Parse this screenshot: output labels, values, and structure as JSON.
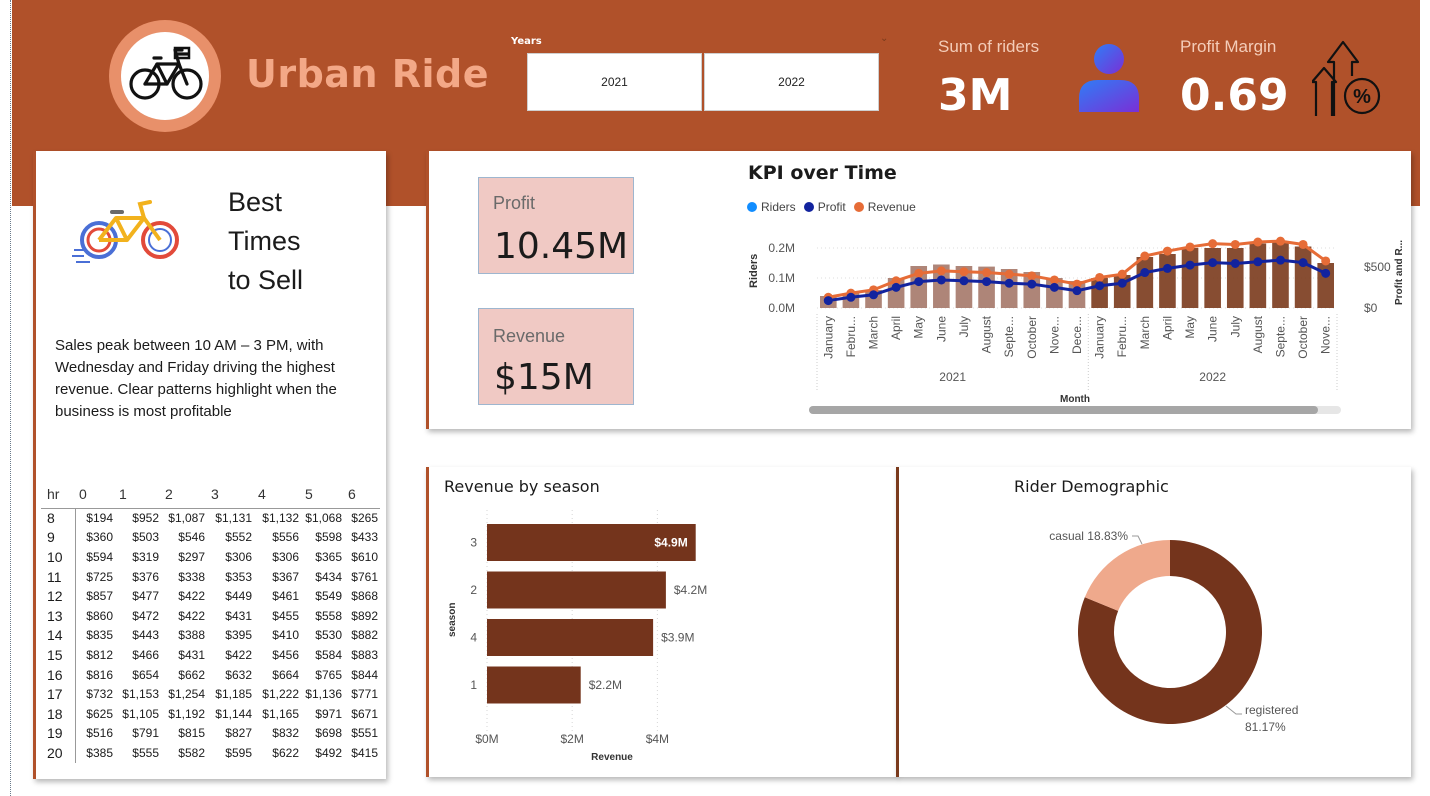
{
  "header": {
    "brand": "Urban Ride",
    "years_label": "Years",
    "years": [
      "2021",
      "2022"
    ],
    "sum_riders_label": "Sum of riders",
    "sum_riders_value": "3M",
    "profit_margin_label": "Profit Margin",
    "profit_margin_value": "0.69",
    "colors": {
      "banner": "#b0512a",
      "accent": "#f3a887"
    }
  },
  "best_times": {
    "title_lines": [
      "Best",
      "Times",
      "to Sell"
    ],
    "description": "Sales peak between 10 AM – 3 PM, with Wednesday and Friday driving the highest revenue. Clear patterns highlight when the business is most profitable",
    "table": {
      "header": [
        "hr",
        "0",
        "1",
        "2",
        "3",
        "4",
        "5",
        "6"
      ],
      "rows": [
        [
          "8",
          "$194",
          "$952",
          "$1,087",
          "$1,131",
          "$1,132",
          "$1,068",
          "$265"
        ],
        [
          "9",
          "$360",
          "$503",
          "$546",
          "$552",
          "$556",
          "$598",
          "$433"
        ],
        [
          "10",
          "$594",
          "$319",
          "$297",
          "$306",
          "$306",
          "$365",
          "$610"
        ],
        [
          "11",
          "$725",
          "$376",
          "$338",
          "$353",
          "$367",
          "$434",
          "$761"
        ],
        [
          "12",
          "$857",
          "$477",
          "$422",
          "$449",
          "$461",
          "$549",
          "$868"
        ],
        [
          "13",
          "$860",
          "$472",
          "$422",
          "$431",
          "$455",
          "$558",
          "$892"
        ],
        [
          "14",
          "$835",
          "$443",
          "$388",
          "$395",
          "$410",
          "$530",
          "$882"
        ],
        [
          "15",
          "$812",
          "$466",
          "$431",
          "$422",
          "$456",
          "$584",
          "$883"
        ],
        [
          "16",
          "$816",
          "$654",
          "$662",
          "$632",
          "$664",
          "$765",
          "$844"
        ],
        [
          "17",
          "$732",
          "$1,153",
          "$1,254",
          "$1,185",
          "$1,222",
          "$1,136",
          "$771"
        ],
        [
          "18",
          "$625",
          "$1,105",
          "$1,192",
          "$1,144",
          "$1,165",
          "$971",
          "$671"
        ],
        [
          "19",
          "$516",
          "$791",
          "$815",
          "$827",
          "$832",
          "$698",
          "$551"
        ],
        [
          "20",
          "$385",
          "$555",
          "$582",
          "$595",
          "$622",
          "$492",
          "$415"
        ]
      ]
    }
  },
  "kpis": {
    "profit_label": "Profit",
    "profit_value": "10.45M",
    "revenue_label": "Revenue",
    "revenue_value": "$15M"
  },
  "kpi_chart": {
    "title": "KPI over Time",
    "legend": [
      {
        "name": "Riders",
        "color": "#118dff"
      },
      {
        "name": "Profit",
        "color": "#12239e"
      },
      {
        "name": "Revenue",
        "color": "#e66c37"
      }
    ]
  },
  "chart_data": [
    {
      "type": "bar",
      "title": "KPI over Time",
      "xlabel": "Month",
      "ylabel": "Riders",
      "y2label": "Profit and R...",
      "categories": [
        "January",
        "Febru...",
        "March",
        "April",
        "May",
        "June",
        "July",
        "August",
        "Septe...",
        "October",
        "Nove...",
        "Dece...",
        "January",
        "Febru...",
        "March",
        "April",
        "May",
        "June",
        "July",
        "August",
        "Septe...",
        "October",
        "Nove..."
      ],
      "groups": [
        {
          "label": "2021",
          "count": 12
        },
        {
          "label": "2022",
          "count": 11
        }
      ],
      "yticks": [
        "0.0M",
        "0.1M",
        "0.2M"
      ],
      "y2ticks": [
        "$0",
        "$500"
      ],
      "ylim": [
        0,
        0.22
      ],
      "y2lim": [
        0,
        800
      ],
      "series": [
        {
          "name": "Riders",
          "chart": "bar",
          "values": [
            0.04,
            0.05,
            0.06,
            0.1,
            0.14,
            0.145,
            0.14,
            0.138,
            0.13,
            0.12,
            0.1,
            0.09,
            0.1,
            0.11,
            0.17,
            0.18,
            0.2,
            0.2,
            0.2,
            0.215,
            0.22,
            0.205,
            0.15
          ]
        },
        {
          "name": "Profit",
          "chart": "line",
          "values": [
            90,
            130,
            160,
            250,
            320,
            340,
            330,
            320,
            300,
            290,
            250,
            210,
            270,
            300,
            430,
            480,
            520,
            550,
            540,
            560,
            580,
            550,
            420
          ]
        },
        {
          "name": "Revenue",
          "chart": "line",
          "values": [
            130,
            180,
            220,
            330,
            420,
            450,
            440,
            430,
            410,
            390,
            340,
            290,
            370,
            410,
            630,
            690,
            740,
            780,
            770,
            800,
            810,
            770,
            570
          ]
        }
      ],
      "colors": {
        "bars_2021": "#a07060",
        "bars_2022": "#7a3a1c",
        "profit": "#12239e",
        "revenue": "#e66c37"
      }
    },
    {
      "type": "bar",
      "orientation": "horizontal",
      "title": "Revenue by season",
      "xlabel": "Revenue",
      "ylabel": "season",
      "categories": [
        "3",
        "2",
        "4",
        "1"
      ],
      "values": [
        4.9,
        4.2,
        3.9,
        2.2
      ],
      "value_labels": [
        "$4.9M",
        "$4.2M",
        "$3.9M",
        "$2.2M"
      ],
      "xticks": [
        "$0M",
        "$2M",
        "$4M"
      ],
      "xlim": [
        0,
        5.4
      ],
      "color": "#74341c"
    },
    {
      "type": "pie",
      "donut": true,
      "title": "Rider Demographic",
      "labels": [
        "registered",
        "casual"
      ],
      "values": [
        81.17,
        18.83
      ],
      "value_labels": [
        "81.17%",
        "18.83%"
      ],
      "colors": [
        "#74341c",
        "#efa98c"
      ]
    }
  ]
}
